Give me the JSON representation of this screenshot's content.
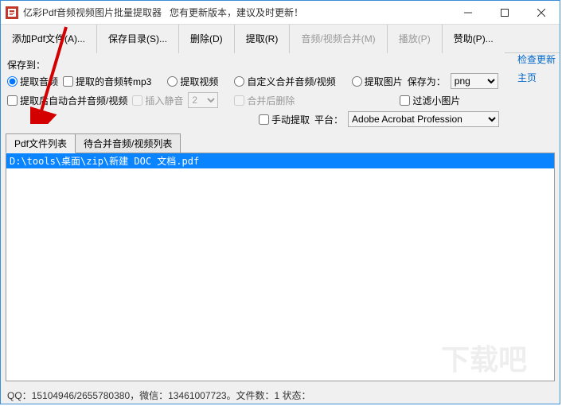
{
  "window": {
    "title": "亿彩Pdf音频视频图片批量提取器",
    "subtitle": "您有更新版本，建议及时更新！"
  },
  "toolbar": {
    "add": "添加Pdf文件(A)...",
    "saveDir": "保存目录(S)...",
    "delete": "删除(D)",
    "extract": "提取(R)",
    "merge": "音频/视频合并(M)",
    "play": "播放(P)",
    "sponsor": "赞助(P)..."
  },
  "opts": {
    "saveTo": "保存到：",
    "extractAudio": "提取音频",
    "audioToMp3": "提取的音频转mp3",
    "extractVideo": "提取视频",
    "customMerge": "自定义合并音频/视频",
    "extractImage": "提取图片",
    "saveAs": "保存为：",
    "format": "png",
    "autoMerge": "提取后自动合并音频/视频",
    "insertSilence": "插入静音",
    "silenceVal": "2",
    "deleteAfterMerge": "合并后删除",
    "filterSmall": "过滤小图片",
    "manualExtract": "手动提取",
    "platform": "平台：",
    "platformVal": "Adobe Acrobat Profession"
  },
  "links": {
    "update": "检查更新",
    "home": "主页"
  },
  "tabs": {
    "files": "Pdf文件列表",
    "mergeList": "待合并音频/视频列表"
  },
  "list": {
    "item0": "D:\\tools\\桌面\\zip\\新建 DOC 文档.pdf"
  },
  "status": {
    "text": "QQ：15104946/2655780380，微信：13461007723。文件数：1  状态："
  },
  "watermark": "下载吧"
}
